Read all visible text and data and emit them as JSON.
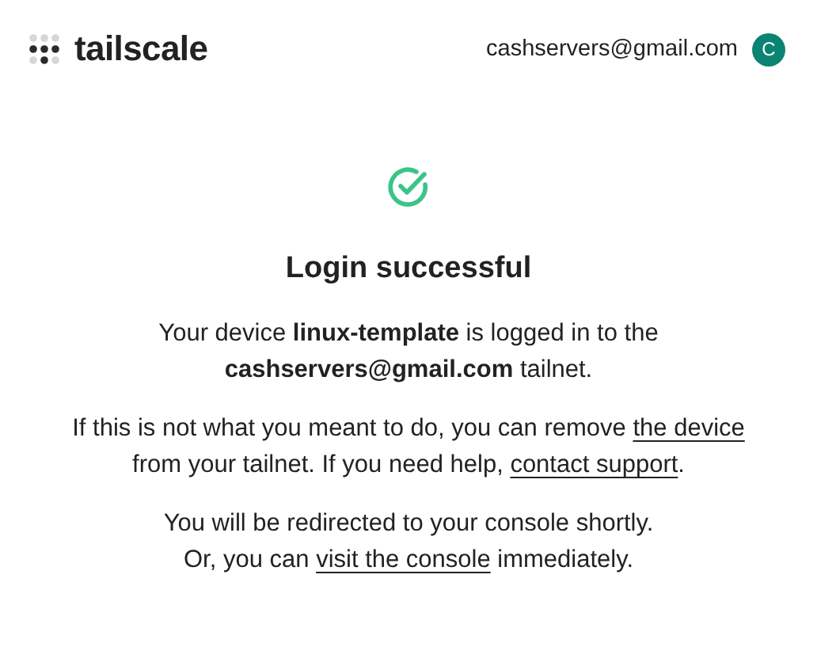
{
  "header": {
    "brand": "tailscale",
    "account": {
      "email": "cashservers@gmail.com",
      "avatar_letter": "C",
      "color": "#0a8472"
    }
  },
  "status": {
    "kind": "success",
    "title": "Login successful"
  },
  "paragraphs": [
    {
      "segments": [
        {
          "kind": "text",
          "text": "Your device **linux-template** is logged in to the"
        },
        {
          "kind": "break"
        },
        {
          "kind": "text",
          "text": "**cashservers@gmail.com** tailnet."
        }
      ]
    },
    {
      "segments": [
        {
          "kind": "text",
          "text": "If this is not what you meant to do, you can remove "
        },
        {
          "kind": "link",
          "text": "the device"
        },
        {
          "kind": "break"
        },
        {
          "kind": "text",
          "text": "from your tailnet. If you need help, "
        },
        {
          "kind": "link",
          "text": "contact support"
        },
        {
          "kind": "text",
          "text": "."
        }
      ]
    },
    {
      "segments": [
        {
          "kind": "text",
          "text": "You will be redirected to your console shortly."
        },
        {
          "kind": "break"
        },
        {
          "kind": "text",
          "text": "Or, you can "
        },
        {
          "kind": "link",
          "text": "visit the console"
        },
        {
          "kind": "text",
          "text": " immediately."
        }
      ]
    }
  ]
}
